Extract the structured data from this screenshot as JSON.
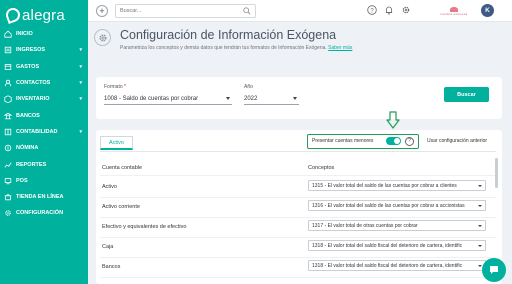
{
  "app": {
    "brand": "alegra",
    "accent": "#00b19d"
  },
  "sidebar": {
    "items": [
      {
        "label": "INICIO",
        "icon": "home-icon",
        "has_submenu": false
      },
      {
        "label": "INGRESOS",
        "icon": "income-icon",
        "has_submenu": true
      },
      {
        "label": "GASTOS",
        "icon": "expenses-icon",
        "has_submenu": true
      },
      {
        "label": "CONTACTOS",
        "icon": "contacts-icon",
        "has_submenu": true
      },
      {
        "label": "INVENTARIO",
        "icon": "inventory-icon",
        "has_submenu": true
      },
      {
        "label": "BANCOS",
        "icon": "bank-icon",
        "has_submenu": false
      },
      {
        "label": "CONTABILIDAD",
        "icon": "accounting-icon",
        "has_submenu": true
      },
      {
        "label": "NÓMINA",
        "icon": "payroll-icon",
        "has_submenu": false
      },
      {
        "label": "REPORTES",
        "icon": "reports-icon",
        "has_submenu": false
      },
      {
        "label": "POS",
        "icon": "pos-icon",
        "has_submenu": false
      },
      {
        "label": "TIENDA EN LÍNEA",
        "icon": "store-icon",
        "has_submenu": false
      },
      {
        "label": "CONFIGURACIÓN",
        "icon": "settings-icon",
        "has_submenu": false
      }
    ],
    "chevron": "▾"
  },
  "topbar": {
    "add_label": "+",
    "search_placeholder": "Buscar...",
    "company_name": "nombre empresa",
    "avatar_initial": "K"
  },
  "page": {
    "title": "Configuración de Información Exógena",
    "subtitle": "Parametriza los conceptos y demás datos que tendrán tus formatos de Información Exógena.",
    "link": "Saber más"
  },
  "filters": {
    "formato_label": "Formato",
    "required_mark": "*",
    "formato_value": "1008 - Saldo de cuentas por cobrar",
    "anio_label": "Año",
    "anio_value": "2022",
    "search_button": "Buscar"
  },
  "table": {
    "tab_label": "Activo",
    "presentar_label": "Presentar cuentas menores",
    "presentar_enabled": true,
    "help_symbol": "?",
    "usar_config_label": "Usar configuración anterior",
    "col_cuenta": "Cuenta contable",
    "col_conceptos": "Conceptos",
    "rows": [
      {
        "cuenta": "Activo",
        "concepto": "1315 - El valor total del saldo de las cuentas por cobrar a clientes"
      },
      {
        "cuenta": "Activo corriente",
        "concepto": "1316 - El valor total del saldo de las cuentas por cobrar a accionistas"
      },
      {
        "cuenta": "Efectivo y equivalentes de efectivo",
        "concepto": "1317 - El valor total de otras cuentas por cobrar"
      },
      {
        "cuenta": "Caja",
        "concepto": "1318 - El valor total del saldo fiscal del deterioro de cartera, identific"
      },
      {
        "cuenta": "Bancos",
        "concepto": "1318 - El valor total del saldo fiscal del deterioro de cartera, identific"
      },
      {
        "cuenta": "",
        "concepto": ""
      }
    ]
  }
}
